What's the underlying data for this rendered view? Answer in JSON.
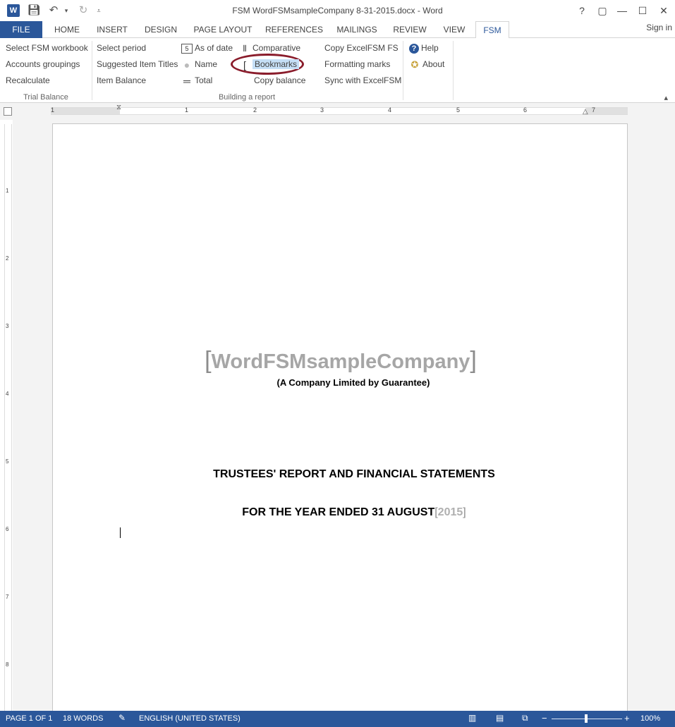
{
  "titlebar": {
    "title": "FSM WordFSMsampleCompany 8-31-2015.docx - Word",
    "help": "?",
    "restore_ribbon": "▢",
    "minimize": "—",
    "maximize": "☐",
    "close": "✕"
  },
  "tabs": {
    "file": "FILE",
    "home": "HOME",
    "insert": "INSERT",
    "design": "DESIGN",
    "page_layout": "PAGE LAYOUT",
    "references": "REFERENCES",
    "mailings": "MAILINGS",
    "review": "REVIEW",
    "view": "VIEW",
    "fsm": "FSM",
    "sign_in": "Sign in"
  },
  "ribbon": {
    "trial_balance": {
      "label": "Trial Balance",
      "select_workbook": "Select FSM workbook",
      "accounts_groupings": "Accounts groupings",
      "recalculate": "Recalculate"
    },
    "building_report": {
      "label": "Building a report",
      "select_period": "Select period",
      "suggested_titles": "Suggested Item Titles",
      "item_balance": "Item Balance",
      "as_of_date": "As of date",
      "name": "Name",
      "total": "Total",
      "comparative": "Comparative",
      "bookmarks": "Bookmarks",
      "copy_balance": "Copy balance",
      "copy_excel_fs": "Copy ExcelFSM FS",
      "formatting_marks": "Formatting marks",
      "sync": "Sync with ExcelFSM"
    },
    "help_group": {
      "help": "Help",
      "about": "About"
    }
  },
  "ruler": {
    "numbers": [
      "1",
      "1",
      "2",
      "3",
      "4",
      "5",
      "6",
      "7"
    ],
    "vnumbers": [
      "1",
      "2",
      "3",
      "4",
      "5",
      "6",
      "7",
      "8"
    ]
  },
  "document": {
    "company_name": "WordFSMsampleCompany",
    "subtitle": "(A Company Limited by Guarantee)",
    "report_title": "TRUSTEES' REPORT AND FINANCIAL STATEMENTS",
    "year_prefix": "FOR THE YEAR ENDED 31 AUGUST",
    "year": "2015"
  },
  "statusbar": {
    "page": "PAGE 1 OF 1",
    "words": "18 WORDS",
    "language": "ENGLISH (UNITED STATES)",
    "zoom": "100%",
    "zoom_minus": "−",
    "zoom_plus": "+"
  },
  "colors": {
    "accent": "#2b579a",
    "bookmark_oval": "#8a1c2b",
    "highlight": "#c5dff6"
  }
}
